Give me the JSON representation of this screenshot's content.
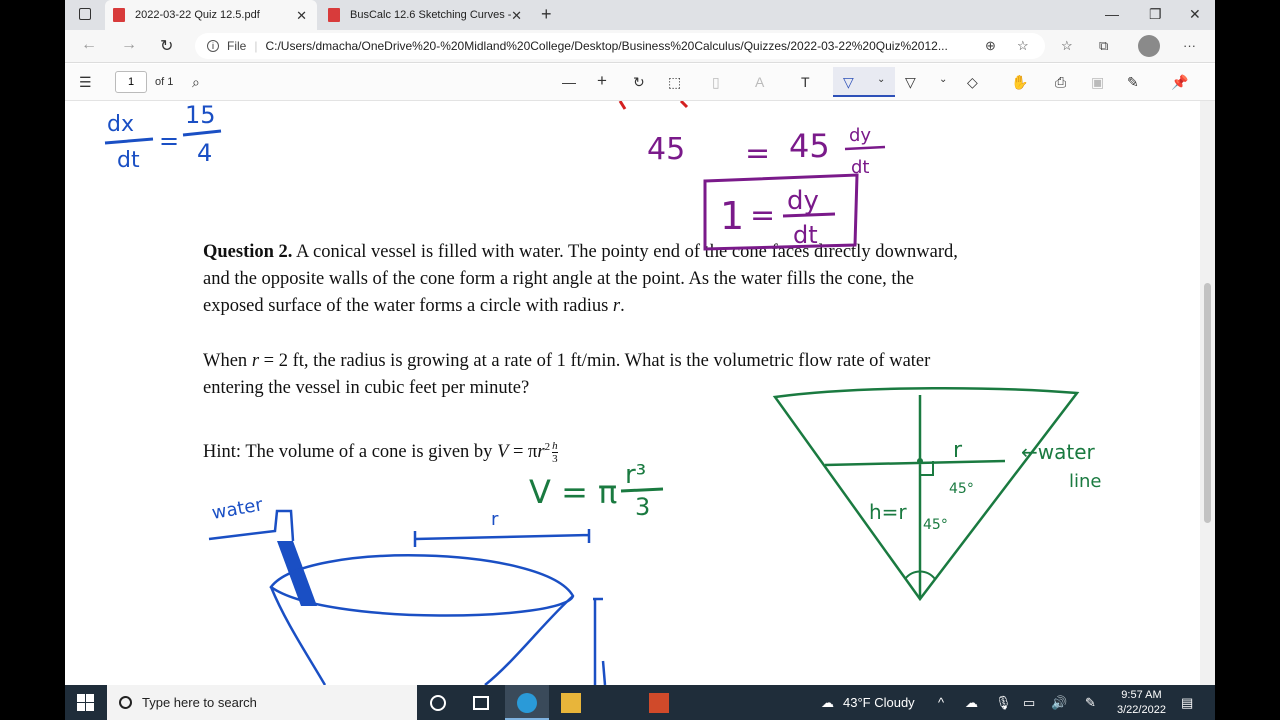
{
  "browser": {
    "tabs": [
      {
        "label": "2022-03-22 Quiz 12.5.pdf"
      },
      {
        "label": "BusCalc 12.6 Sketching Curves -"
      }
    ],
    "address": {
      "scheme_label": "File",
      "url": "C:/Users/dmacha/OneDrive%20-%20Midland%20College/Desktop/Business%20Calculus/Quizzes/2022-03-22%20Quiz%2012..."
    }
  },
  "pdf_toolbar": {
    "page_number": "1",
    "page_of": "of 1"
  },
  "document": {
    "q2_title": "Question 2.",
    "q2_line1": " A conical vessel is filled with water. The pointy end of the cone faces directly downward,",
    "q2_line2": "and the opposite walls of the cone form a right angle at the point. As the water fills the cone, the",
    "q2_line3": "exposed surface of the water forms a circle with radius ",
    "q2_var_r": "r",
    "q2_end": ".",
    "q2b_line1_a": "When ",
    "q2b_line1_b": " = 2 ft, the radius is growing at a rate of 1 ft/min. What is the volumetric flow rate of water",
    "q2b_line2": "entering the vessel in cubic feet per minute?",
    "hint_a": "Hint: The volume of a cone is given by ",
    "hint_V": "V",
    "hint_eq": " = π",
    "hint_r": "r",
    "hint_exp": "2",
    "hint_h": "h",
    "hint_3": "3",
    "handwriting": {
      "dxdt_num": "dx",
      "dxdt_den": "dt",
      "fifteen": "15",
      "four": "4",
      "eq1": "=",
      "fortyfive_left": "45",
      "eq2": "=",
      "fortyfive_right": "45",
      "dy": "dy",
      "dt": "dt",
      "box_one": "1",
      "box_eq": "=",
      "box_dy": "dy",
      "box_dt": "dt",
      "volume_eq": "V = π",
      "r_cubed": "r³",
      "three": "3",
      "water_label": "water",
      "r_label": "r",
      "cone_r": "r",
      "angle1": "45°",
      "angle2": "45°",
      "h_eq_r": "h=r",
      "water_line1": "←water",
      "water_line2": "line"
    }
  },
  "taskbar": {
    "search_placeholder": "Type here to search",
    "weather": "43°F  Cloudy",
    "time": "9:57 AM",
    "date": "3/22/2022"
  },
  "colors": {
    "ink_blue": "#1a4fc4",
    "ink_green": "#1a7a40",
    "ink_purple": "#7a1a8a",
    "ink_red": "#d42020"
  }
}
